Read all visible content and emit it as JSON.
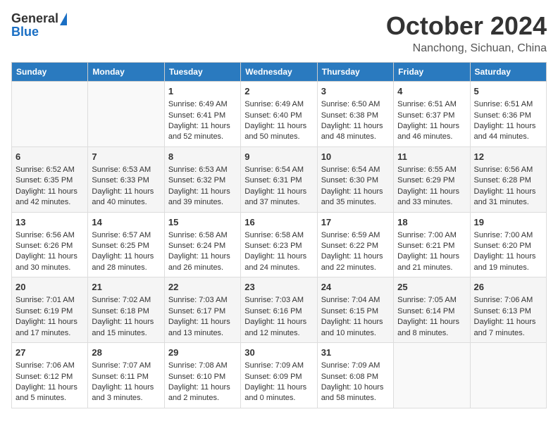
{
  "header": {
    "logo": {
      "line1": "General",
      "line2": "Blue"
    },
    "title": "October 2024",
    "location": "Nanchong, Sichuan, China"
  },
  "days_of_week": [
    "Sunday",
    "Monday",
    "Tuesday",
    "Wednesday",
    "Thursday",
    "Friday",
    "Saturday"
  ],
  "weeks": [
    [
      {
        "day": "",
        "data": ""
      },
      {
        "day": "",
        "data": ""
      },
      {
        "day": "1",
        "sunrise": "Sunrise: 6:49 AM",
        "sunset": "Sunset: 6:41 PM",
        "daylight": "Daylight: 11 hours and 52 minutes."
      },
      {
        "day": "2",
        "sunrise": "Sunrise: 6:49 AM",
        "sunset": "Sunset: 6:40 PM",
        "daylight": "Daylight: 11 hours and 50 minutes."
      },
      {
        "day": "3",
        "sunrise": "Sunrise: 6:50 AM",
        "sunset": "Sunset: 6:38 PM",
        "daylight": "Daylight: 11 hours and 48 minutes."
      },
      {
        "day": "4",
        "sunrise": "Sunrise: 6:51 AM",
        "sunset": "Sunset: 6:37 PM",
        "daylight": "Daylight: 11 hours and 46 minutes."
      },
      {
        "day": "5",
        "sunrise": "Sunrise: 6:51 AM",
        "sunset": "Sunset: 6:36 PM",
        "daylight": "Daylight: 11 hours and 44 minutes."
      }
    ],
    [
      {
        "day": "6",
        "sunrise": "Sunrise: 6:52 AM",
        "sunset": "Sunset: 6:35 PM",
        "daylight": "Daylight: 11 hours and 42 minutes."
      },
      {
        "day": "7",
        "sunrise": "Sunrise: 6:53 AM",
        "sunset": "Sunset: 6:33 PM",
        "daylight": "Daylight: 11 hours and 40 minutes."
      },
      {
        "day": "8",
        "sunrise": "Sunrise: 6:53 AM",
        "sunset": "Sunset: 6:32 PM",
        "daylight": "Daylight: 11 hours and 39 minutes."
      },
      {
        "day": "9",
        "sunrise": "Sunrise: 6:54 AM",
        "sunset": "Sunset: 6:31 PM",
        "daylight": "Daylight: 11 hours and 37 minutes."
      },
      {
        "day": "10",
        "sunrise": "Sunrise: 6:54 AM",
        "sunset": "Sunset: 6:30 PM",
        "daylight": "Daylight: 11 hours and 35 minutes."
      },
      {
        "day": "11",
        "sunrise": "Sunrise: 6:55 AM",
        "sunset": "Sunset: 6:29 PM",
        "daylight": "Daylight: 11 hours and 33 minutes."
      },
      {
        "day": "12",
        "sunrise": "Sunrise: 6:56 AM",
        "sunset": "Sunset: 6:28 PM",
        "daylight": "Daylight: 11 hours and 31 minutes."
      }
    ],
    [
      {
        "day": "13",
        "sunrise": "Sunrise: 6:56 AM",
        "sunset": "Sunset: 6:26 PM",
        "daylight": "Daylight: 11 hours and 30 minutes."
      },
      {
        "day": "14",
        "sunrise": "Sunrise: 6:57 AM",
        "sunset": "Sunset: 6:25 PM",
        "daylight": "Daylight: 11 hours and 28 minutes."
      },
      {
        "day": "15",
        "sunrise": "Sunrise: 6:58 AM",
        "sunset": "Sunset: 6:24 PM",
        "daylight": "Daylight: 11 hours and 26 minutes."
      },
      {
        "day": "16",
        "sunrise": "Sunrise: 6:58 AM",
        "sunset": "Sunset: 6:23 PM",
        "daylight": "Daylight: 11 hours and 24 minutes."
      },
      {
        "day": "17",
        "sunrise": "Sunrise: 6:59 AM",
        "sunset": "Sunset: 6:22 PM",
        "daylight": "Daylight: 11 hours and 22 minutes."
      },
      {
        "day": "18",
        "sunrise": "Sunrise: 7:00 AM",
        "sunset": "Sunset: 6:21 PM",
        "daylight": "Daylight: 11 hours and 21 minutes."
      },
      {
        "day": "19",
        "sunrise": "Sunrise: 7:00 AM",
        "sunset": "Sunset: 6:20 PM",
        "daylight": "Daylight: 11 hours and 19 minutes."
      }
    ],
    [
      {
        "day": "20",
        "sunrise": "Sunrise: 7:01 AM",
        "sunset": "Sunset: 6:19 PM",
        "daylight": "Daylight: 11 hours and 17 minutes."
      },
      {
        "day": "21",
        "sunrise": "Sunrise: 7:02 AM",
        "sunset": "Sunset: 6:18 PM",
        "daylight": "Daylight: 11 hours and 15 minutes."
      },
      {
        "day": "22",
        "sunrise": "Sunrise: 7:03 AM",
        "sunset": "Sunset: 6:17 PM",
        "daylight": "Daylight: 11 hours and 13 minutes."
      },
      {
        "day": "23",
        "sunrise": "Sunrise: 7:03 AM",
        "sunset": "Sunset: 6:16 PM",
        "daylight": "Daylight: 11 hours and 12 minutes."
      },
      {
        "day": "24",
        "sunrise": "Sunrise: 7:04 AM",
        "sunset": "Sunset: 6:15 PM",
        "daylight": "Daylight: 11 hours and 10 minutes."
      },
      {
        "day": "25",
        "sunrise": "Sunrise: 7:05 AM",
        "sunset": "Sunset: 6:14 PM",
        "daylight": "Daylight: 11 hours and 8 minutes."
      },
      {
        "day": "26",
        "sunrise": "Sunrise: 7:06 AM",
        "sunset": "Sunset: 6:13 PM",
        "daylight": "Daylight: 11 hours and 7 minutes."
      }
    ],
    [
      {
        "day": "27",
        "sunrise": "Sunrise: 7:06 AM",
        "sunset": "Sunset: 6:12 PM",
        "daylight": "Daylight: 11 hours and 5 minutes."
      },
      {
        "day": "28",
        "sunrise": "Sunrise: 7:07 AM",
        "sunset": "Sunset: 6:11 PM",
        "daylight": "Daylight: 11 hours and 3 minutes."
      },
      {
        "day": "29",
        "sunrise": "Sunrise: 7:08 AM",
        "sunset": "Sunset: 6:10 PM",
        "daylight": "Daylight: 11 hours and 2 minutes."
      },
      {
        "day": "30",
        "sunrise": "Sunrise: 7:09 AM",
        "sunset": "Sunset: 6:09 PM",
        "daylight": "Daylight: 11 hours and 0 minutes."
      },
      {
        "day": "31",
        "sunrise": "Sunrise: 7:09 AM",
        "sunset": "Sunset: 6:08 PM",
        "daylight": "Daylight: 10 hours and 58 minutes."
      },
      {
        "day": "",
        "data": ""
      },
      {
        "day": "",
        "data": ""
      }
    ]
  ]
}
